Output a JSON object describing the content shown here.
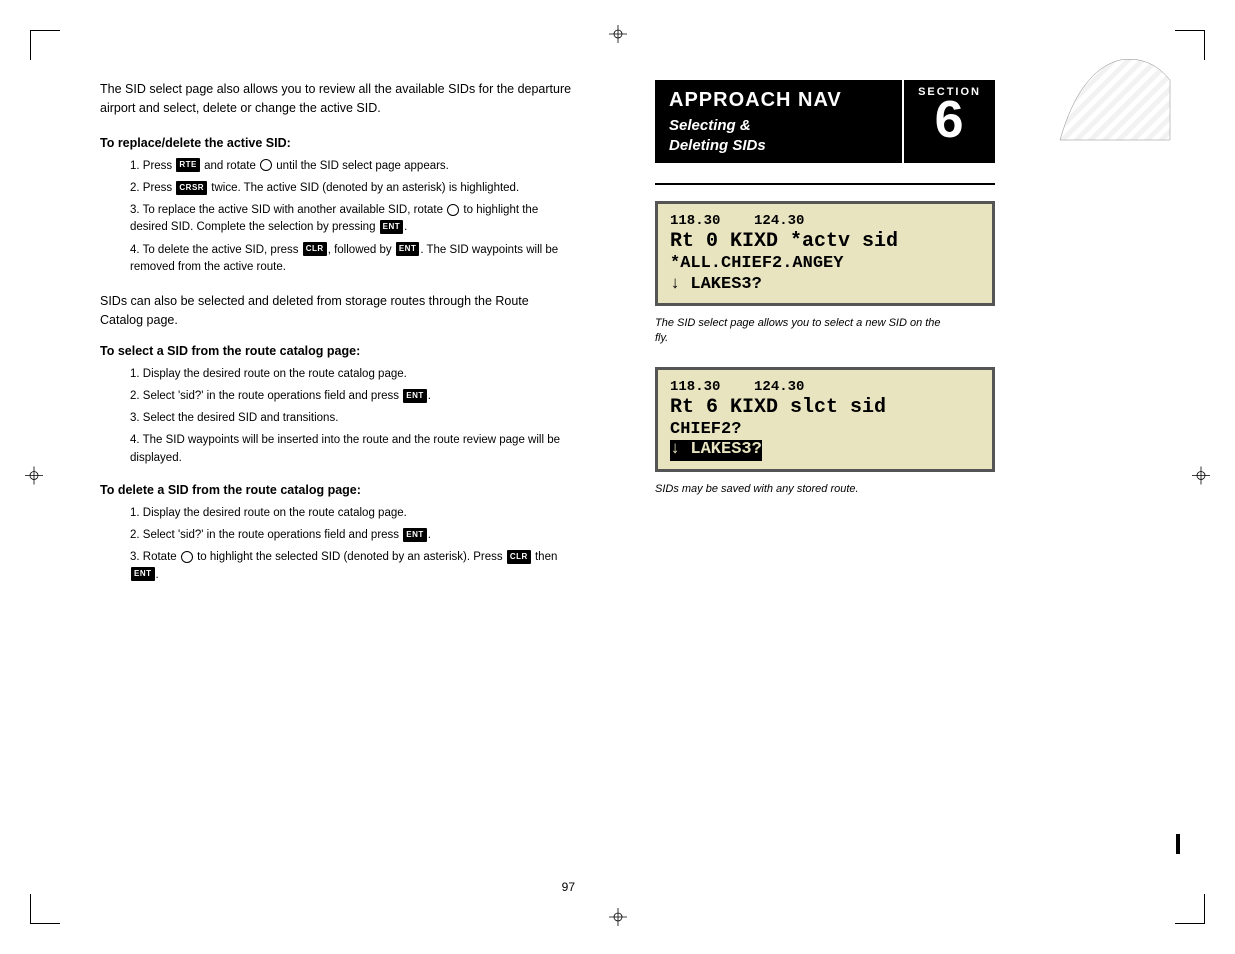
{
  "page": {
    "number": "97",
    "corner_marks": true
  },
  "header": {
    "section_label": "SECTION",
    "section_number": "6",
    "main_title": "APPROACH NAV",
    "sub_title_line1": "Selecting &",
    "sub_title_line2": "Deleting SIDs"
  },
  "intro": {
    "text": "The SID select page also allows you to review all the available SIDs for the departure airport and select, delete or change the active SID."
  },
  "replace_section": {
    "heading": "To replace/delete the active SID:",
    "steps": [
      "1. Press  RTE  and rotate  ○  until the SID select page appears.",
      "2. Press  CRSR  twice. The active SID (denoted by an asterisk) is highlighted.",
      "3. To replace the active SID with another available SID, rotate  ○  to highlight the desired SID. Complete the selection by pressing  ENT .",
      "4. To delete the active SID, press  CLR , followed by  ENT . The SID waypoints will be removed from the active route."
    ]
  },
  "middle_text": {
    "text": "SIDs can also be selected and deleted from storage routes through the Route Catalog page."
  },
  "select_section": {
    "heading": "To select a SID from the route catalog page:",
    "steps": [
      "1. Display the desired route on the route catalog page.",
      "2. Select 'sid?' in the route operations field and press  ENT .",
      "3. Select the desired SID and transitions.",
      "4. The SID waypoints will be inserted into the route and the route review page will be displayed."
    ]
  },
  "delete_section": {
    "heading": "To delete a SID from the route catalog page:",
    "steps": [
      "1. Display the desired route on the route catalog page.",
      "2. Select 'sid?' in the route operations field and press  ENT .",
      "3. Rotate  ○  to highlight the selected SID (denoted by an asterisk). Press  CLR  then  ENT ."
    ]
  },
  "screen1": {
    "freq1": "118.30",
    "freq2": "124.30",
    "line1": "Rt 0 KIXD *actv sid",
    "line2": "*ALL.CHIEF2.ANGEY",
    "line3": "↓ LAKES3?",
    "caption": "The SID select page allows you to select a new SID on the fly."
  },
  "screen2": {
    "freq1": "118.30",
    "freq2": "124.30",
    "line1": "Rt 6 KIXD  slct sid",
    "line2": "  CHIEF2?",
    "line3_highlighted": "↓ LAKES3?",
    "caption": "SIDs may be saved with any stored route."
  }
}
